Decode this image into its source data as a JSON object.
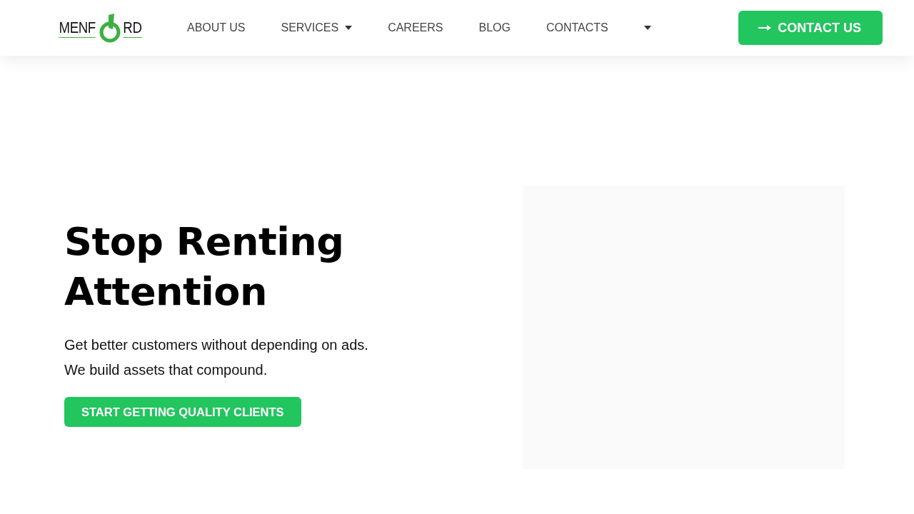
{
  "logo": {
    "left": "MENF",
    "right": "RD"
  },
  "nav": [
    {
      "label": "ABOUT US",
      "dropdown": false
    },
    {
      "label": "SERVICES",
      "dropdown": true
    },
    {
      "label": "CAREERS",
      "dropdown": false
    },
    {
      "label": "BLOG",
      "dropdown": false
    },
    {
      "label": "CONTACTS",
      "dropdown": false
    },
    {
      "dropdown": true
    }
  ],
  "header_button": {
    "label": "CONTACT US"
  },
  "hero": {
    "title": "Stop Renting Attention",
    "lines": [
      "Get better customers without depending on ads.",
      "We build assets that compound."
    ],
    "button": "START GETTING QUALITY CLIENTS"
  }
}
